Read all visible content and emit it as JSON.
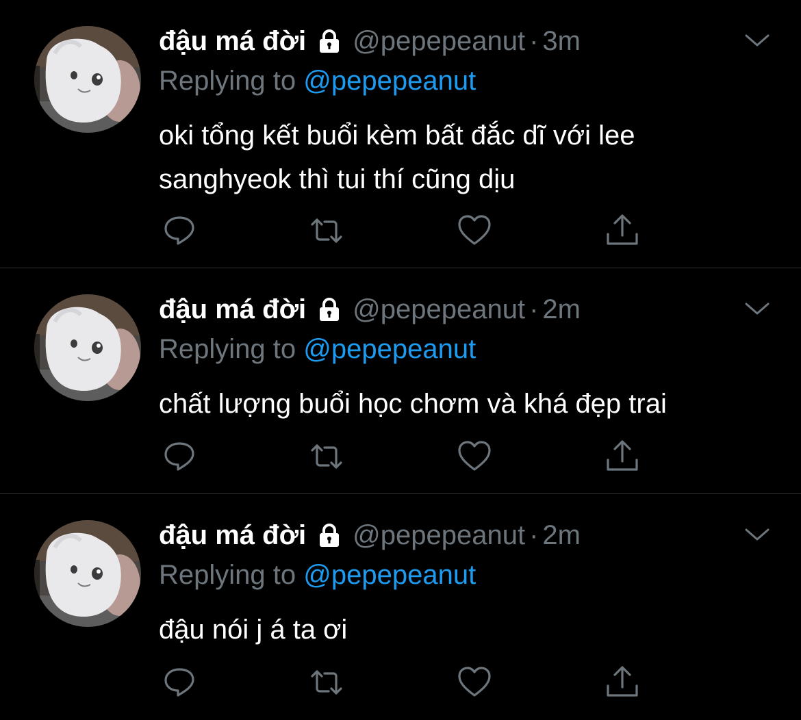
{
  "theme": {
    "background": "#000000",
    "secondary_text": "#6e767d",
    "link": "#1d9bf0",
    "divider": "#2f3336"
  },
  "tweets": [
    {
      "display_name": "đậu má đời",
      "handle": "@pepepeanut",
      "separator": "·",
      "time": "3m",
      "replying_prefix": "Replying to",
      "replying_to": "@pepepeanut",
      "text": "oki tổng kết buổi kèm bất đắc dĩ với lee sanghyeok thì tui thí cũng dịu",
      "icons": {
        "lock": "lock-icon",
        "more": "chevron-down-icon",
        "reply": "reply-icon",
        "retweet": "retweet-icon",
        "like": "heart-icon",
        "share": "share-icon"
      }
    },
    {
      "display_name": "đậu má đời",
      "handle": "@pepepeanut",
      "separator": "·",
      "time": "2m",
      "replying_prefix": "Replying to",
      "replying_to": "@pepepeanut",
      "text": "chất lượng buổi học chơm và khá đẹp trai",
      "icons": {
        "lock": "lock-icon",
        "more": "chevron-down-icon",
        "reply": "reply-icon",
        "retweet": "retweet-icon",
        "like": "heart-icon",
        "share": "share-icon"
      }
    },
    {
      "display_name": "đậu má đời",
      "handle": "@pepepeanut",
      "separator": "·",
      "time": "2m",
      "replying_prefix": "Replying to",
      "replying_to": "@pepepeanut",
      "text": "đậu nói j á ta ơi",
      "icons": {
        "lock": "lock-icon",
        "more": "chevron-down-icon",
        "reply": "reply-icon",
        "retweet": "retweet-icon",
        "like": "heart-icon",
        "share": "share-icon"
      }
    }
  ]
}
